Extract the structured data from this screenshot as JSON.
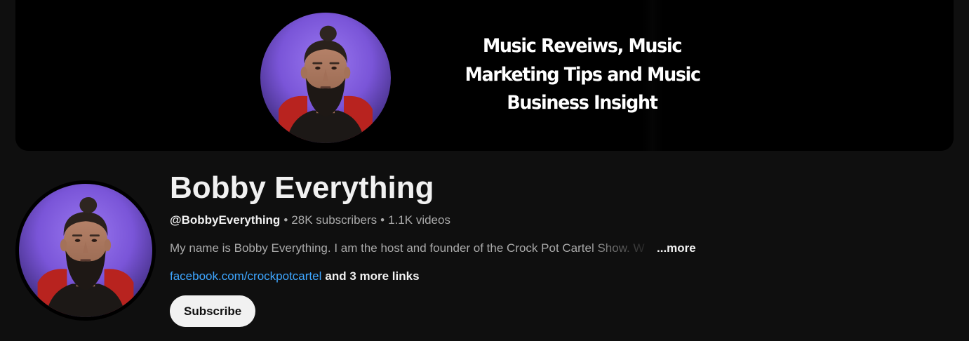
{
  "banner": {
    "tagline_lines": [
      "Music Reveiws, Music",
      "Marketing Tips and Music",
      "Business Insight"
    ],
    "background_color": "#000000"
  },
  "channel": {
    "name": "Bobby Everything",
    "handle": "@BobbyEverything",
    "subscribers": "28K subscribers",
    "videos": "1.1K videos",
    "separator": "•",
    "description": "My name is Bobby Everything. I am the host and founder of the Crock Pot Cartel Show. W",
    "more_label": "...more",
    "link_primary": "facebook.com/crockpotcartel",
    "link_more": "and 3 more links",
    "subscribe_label": "Subscribe"
  },
  "colors": {
    "page_bg": "#0f0f0f",
    "text_primary": "#f1f1f1",
    "text_secondary": "#aaaaaa",
    "link": "#3ea6ff",
    "portrait_backdrop": "#7a55d8",
    "subscribe_bg": "#f1f1f1"
  }
}
